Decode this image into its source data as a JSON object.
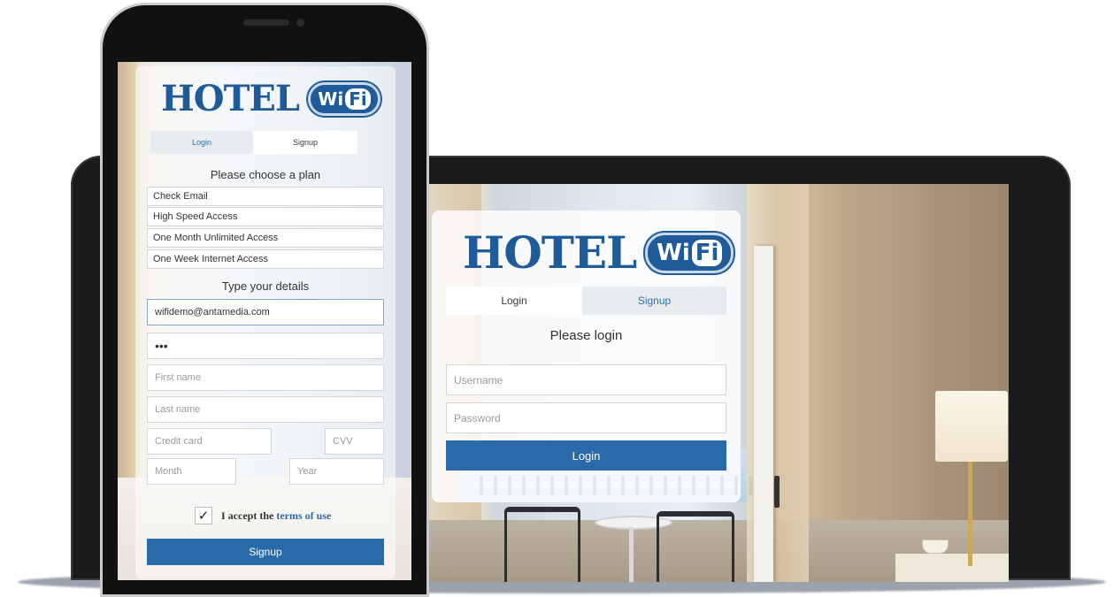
{
  "brand": {
    "logo_text": "HOTEL",
    "badge_w": "Wi",
    "badge_i": "Fi",
    "colors": {
      "primary": "#2b6aa8",
      "logo": "#1f5a99"
    }
  },
  "tablet": {
    "tabs": [
      {
        "label": "Login",
        "active": true
      },
      {
        "label": "Signup",
        "active": false
      }
    ],
    "heading": "Please login",
    "username_placeholder": "Username",
    "password_placeholder": "Password",
    "login_button": "Login"
  },
  "phone": {
    "tabs": [
      {
        "label": "Login",
        "active": false
      },
      {
        "label": "Signup",
        "active": true
      }
    ],
    "plan_heading": "Please choose a plan",
    "plans": [
      "Check Email",
      "High Speed Access",
      "One Month Unlimited Access",
      "One Week Internet Access"
    ],
    "details_heading": "Type your details",
    "email_value": "wifidemo@antamedia.com",
    "password_value": "•••",
    "first_name_placeholder": "First name",
    "last_name_placeholder": "Last name",
    "credit_card_placeholder": "Credit card",
    "cvv_placeholder": "CVV",
    "month_placeholder": "Month",
    "year_placeholder": "Year",
    "checkbox_mark": "✓",
    "accept_text": "I accept the",
    "terms_link": "terms of use",
    "signup_button": "Signup"
  }
}
